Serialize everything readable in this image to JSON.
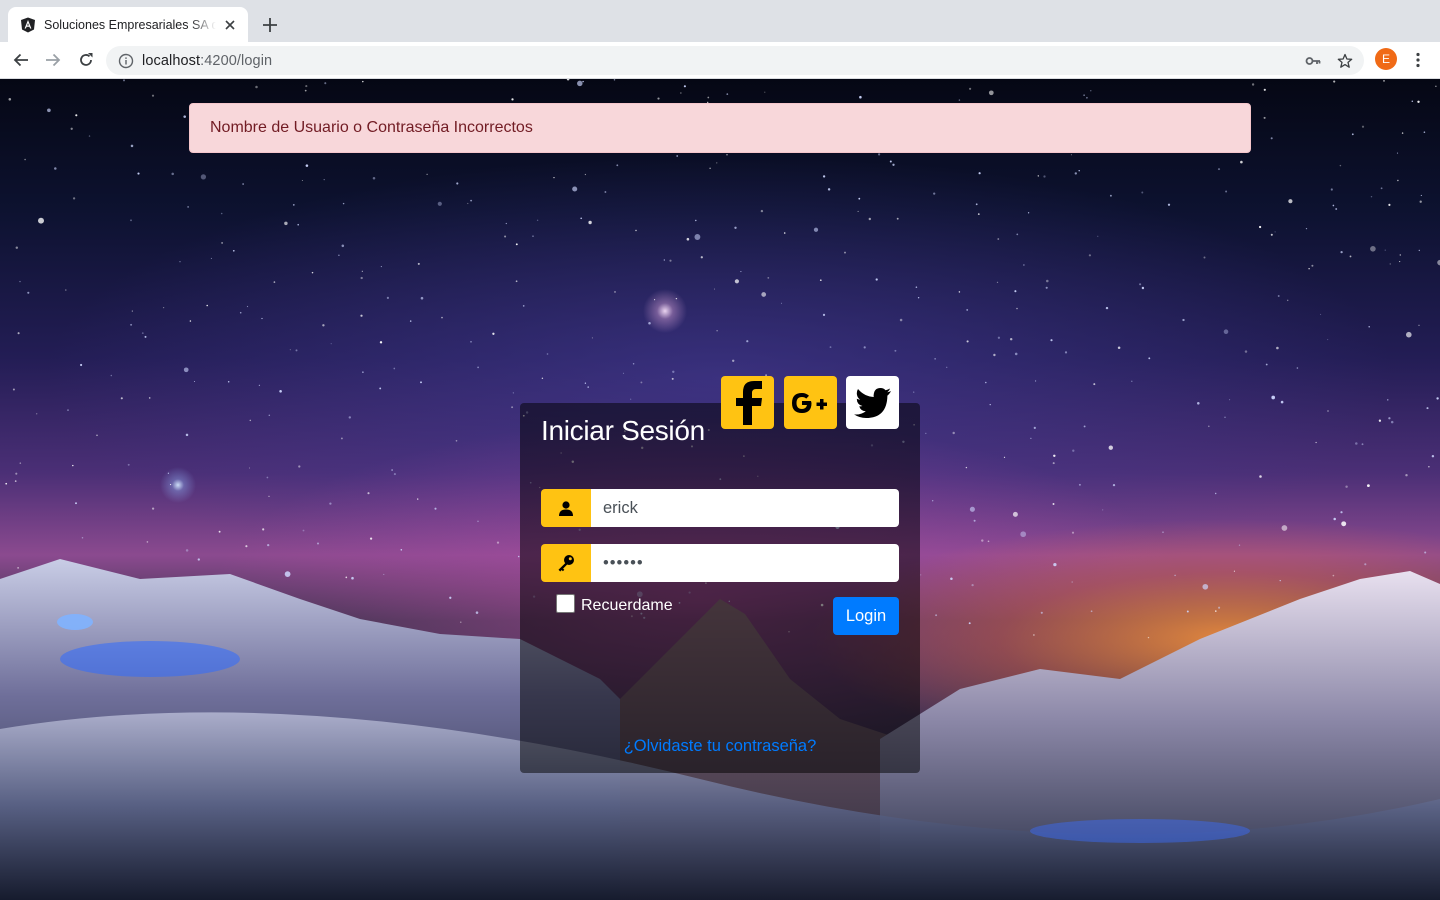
{
  "browser": {
    "tab_title": "Soluciones Empresariales SA de CV",
    "url_host": "localhost",
    "url_path": ":4200/login",
    "profile_initial": "E",
    "icons": [
      "angular-favicon-icon",
      "close-icon",
      "plus-icon",
      "back-arrow-icon",
      "forward-arrow-icon",
      "reload-icon",
      "info-icon",
      "key-icon",
      "star-icon",
      "kebab-menu-icon"
    ]
  },
  "alert": {
    "message": "Nombre de Usuario o Contraseña Incorrectos",
    "color_bg": "#f8d7da",
    "color_text": "#721c24"
  },
  "login": {
    "title": "Iniciar Sesión",
    "username_value": "erick",
    "password_value": "••••••",
    "remember_label": "Recuerdame",
    "remember_checked": false,
    "login_button": "Login",
    "forgot_link": "¿Olvidaste tu contraseña?",
    "accent_color": "#ffc312",
    "button_color": "#007bff"
  },
  "social": {
    "icons": [
      "facebook-icon",
      "google-plus-icon",
      "twitter-icon"
    ]
  }
}
